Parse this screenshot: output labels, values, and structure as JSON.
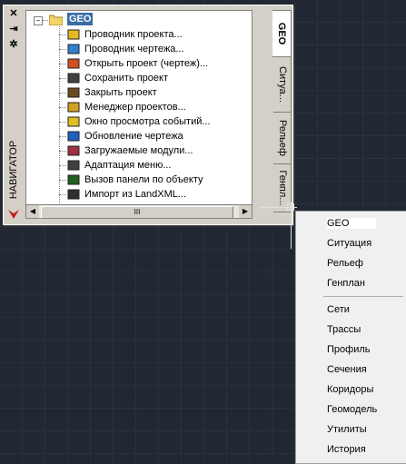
{
  "navigator": {
    "title": "НАВИГАТОР",
    "root_label": "GEO",
    "items": [
      {
        "label": "Проводник проекта...",
        "icon": "project-explorer-icon"
      },
      {
        "label": "Проводник чертежа...",
        "icon": "drawing-explorer-icon"
      },
      {
        "label": "Открыть проект (чертеж)...",
        "icon": "open-project-icon"
      },
      {
        "label": "Сохранить проект",
        "icon": "save-icon"
      },
      {
        "label": "Закрыть проект",
        "icon": "close-project-icon"
      },
      {
        "label": "Менеджер проектов...",
        "icon": "project-manager-icon"
      },
      {
        "label": "Окно просмотра событий...",
        "icon": "event-viewer-icon"
      },
      {
        "label": "Обновление чертежа",
        "icon": "refresh-drawing-icon"
      },
      {
        "label": "Загружаемые модули...",
        "icon": "modules-icon"
      },
      {
        "label": "Адаптация меню...",
        "icon": "menu-adapt-icon"
      },
      {
        "label": "Вызов панели по объекту",
        "icon": "object-panel-icon"
      },
      {
        "label": "Импорт из LandXML...",
        "icon": "import-landxml-icon"
      }
    ],
    "tabs": [
      "GEO",
      "Ситуа...",
      "Рельеф",
      "Генпл..."
    ],
    "scroll_thumb": "III"
  },
  "menu": {
    "items": [
      "GEO",
      "Ситуация",
      "Рельеф",
      "Генплан",
      "Сети",
      "Трассы",
      "Профиль",
      "Сечения",
      "Коридоры",
      "Геомодель",
      "Утилиты",
      "История"
    ]
  }
}
